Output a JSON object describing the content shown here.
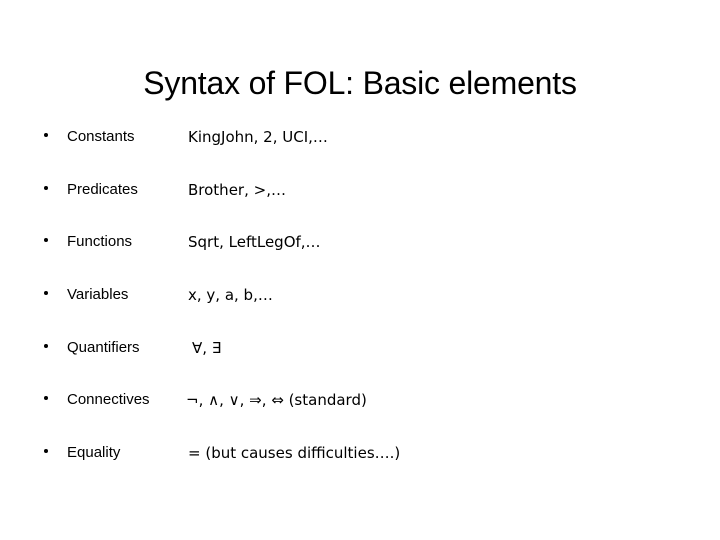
{
  "slide": {
    "title": "Syntax of FOL: Basic elements",
    "background_color": "#ffffff",
    "text_color": "#000000",
    "bullet_glyph": "•",
    "rows": [
      {
        "label": "Constants",
        "value": "KingJohn, 2, UCI,…"
      },
      {
        "label": "Predicates",
        "value": "Brother, >,…"
      },
      {
        "label": "Functions",
        "value": "Sqrt, LeftLegOf,…"
      },
      {
        "label": "Variables",
        "value": "x, y, a, b,…"
      },
      {
        "label": "Quantifiers",
        "value": "∀, ∃"
      },
      {
        "label": "Connectives",
        "value": "¬, ∧, ∨, ⇒, ⇔ (standard)"
      },
      {
        "label": "Equality",
        "value": "= (but causes difficulties….)"
      }
    ]
  }
}
